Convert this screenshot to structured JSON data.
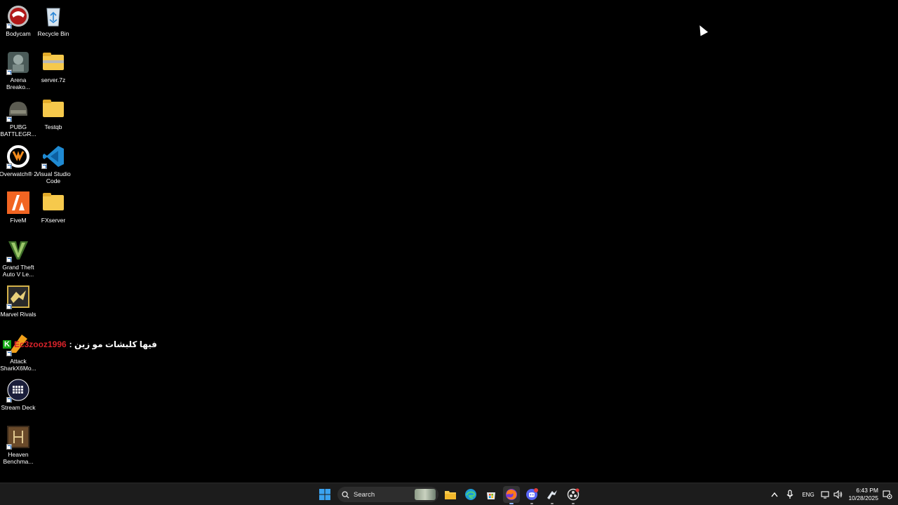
{
  "desktop": {
    "icons": [
      {
        "label": "Bodycam"
      },
      {
        "label": "Recycle Bin"
      },
      {
        "label": "Arena Breako..."
      },
      {
        "label": "server.7z"
      },
      {
        "label": "PUBG BATTLEGR..."
      },
      {
        "label": "Testqb"
      },
      {
        "label": "Overwatch® 2"
      },
      {
        "label": "Visual Studio Code"
      },
      {
        "label": "FiveM"
      },
      {
        "label": "FXserver"
      },
      {
        "label": "Grand Theft Auto V Le..."
      },
      {
        "label": "Marvel Rivals"
      },
      {
        "label": "Attack SharkX6Mo..."
      },
      {
        "label": "Stream Deck"
      },
      {
        "label": "Heaven Benchma..."
      }
    ],
    "overlay": {
      "badge": "K",
      "username": "Ec3zooz1996",
      "message": "فيها كلبشات مو زين :"
    }
  },
  "taskbar": {
    "search_label": "Search",
    "apps": [
      {
        "icon": "start-icon"
      },
      {
        "icon": "file-explorer-icon"
      },
      {
        "icon": "edge-icon"
      },
      {
        "icon": "microsoft-store-icon"
      },
      {
        "icon": "firefox-icon"
      },
      {
        "icon": "discord-icon"
      },
      {
        "icon": "steam-icon"
      },
      {
        "icon": "obs-icon"
      }
    ],
    "tray": {
      "language": "ENG",
      "time": "6:43 PM",
      "date": "10/28/2025"
    }
  },
  "colors": {
    "desktop_bg": "#000000",
    "taskbar_bg": "#1c1c1c",
    "overlay_name": "#d8232a",
    "overlay_badge": "#14a814"
  }
}
